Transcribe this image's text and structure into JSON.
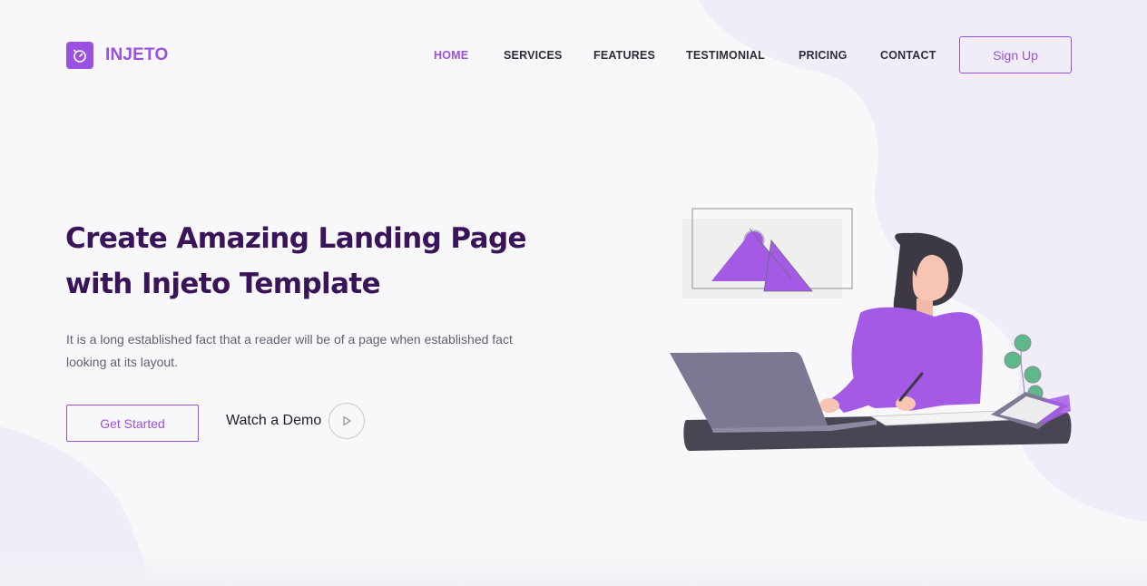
{
  "brand": {
    "name": "INJETO",
    "accent_color": "#9b51e0",
    "heading_color": "#3a1458"
  },
  "nav": {
    "items": [
      {
        "label": "HOME",
        "active": true
      },
      {
        "label": "SERVICES",
        "active": false
      },
      {
        "label": "FEATURES",
        "active": false
      },
      {
        "label": "TESTIMONIAL",
        "active": false
      },
      {
        "label": "PRICING",
        "active": false
      },
      {
        "label": "CONTACT",
        "active": false
      }
    ],
    "signup_label": "Sign Up"
  },
  "hero": {
    "title_line1": "Create Amazing Landing Page",
    "title_line2": "with Injeto Template",
    "description_line1": "It is a long established fact that a reader will be of a page when established fact",
    "description_line2": "looking at its layout.",
    "primary_button": "Get Started",
    "demo_label": "Watch a Demo",
    "demo_icon": "play-icon"
  },
  "illustration": {
    "subject": "woman-working-on-laptop",
    "icons": [
      "picture-frame-icon",
      "laptop-icon",
      "tablet-icon",
      "plant-icon"
    ]
  }
}
